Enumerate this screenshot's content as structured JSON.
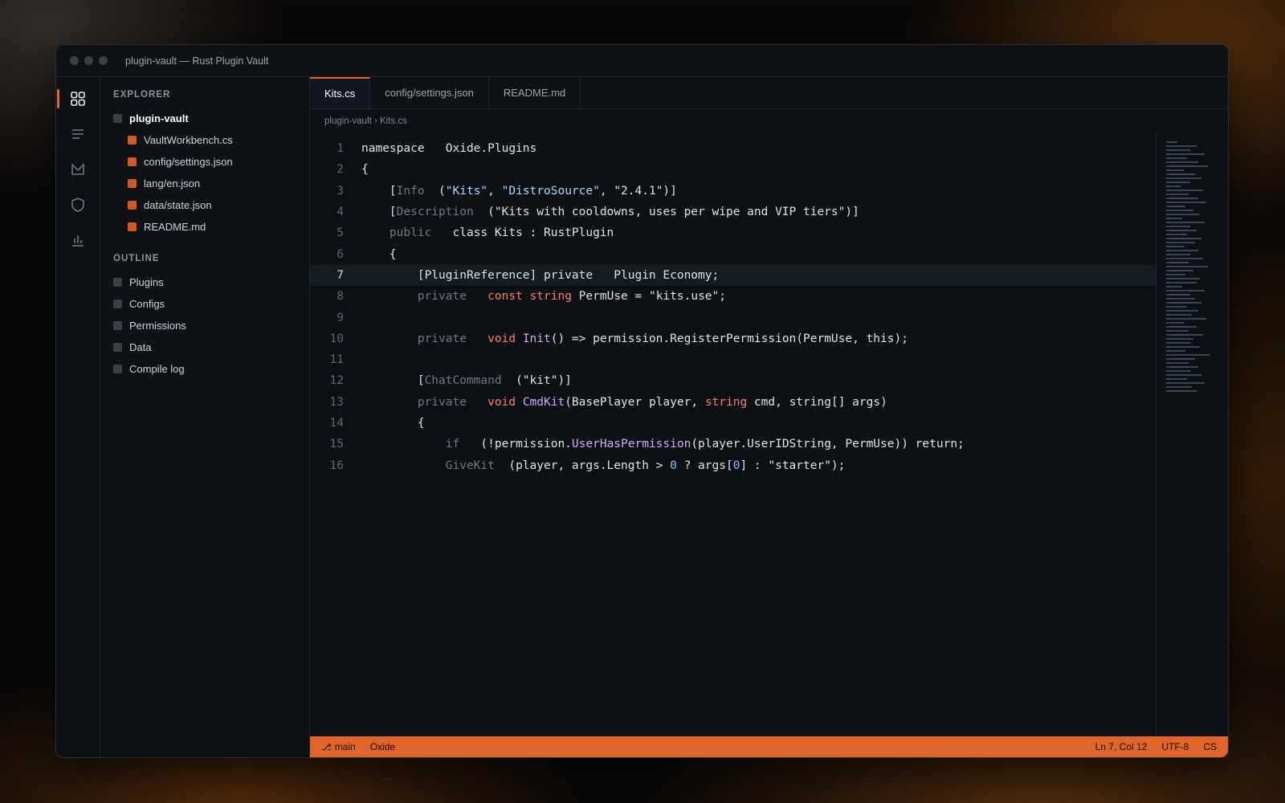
{
  "window": {
    "title": "plugin-vault — Rust Plugin Vault"
  },
  "activity_bar": {
    "items": [
      {
        "icon": "grid-icon",
        "active": true
      },
      {
        "icon": "list-icon",
        "active": false
      },
      {
        "icon": "mail-icon",
        "active": false
      },
      {
        "icon": "shield-icon",
        "active": false
      },
      {
        "icon": "chart-icon",
        "active": false
      }
    ]
  },
  "sidebar": {
    "explorer_title": "EXPLORER",
    "root": "plugin-vault",
    "files": [
      "VaultWorkbench.cs",
      "config/settings.json",
      "lang/en.json",
      "data/state.json",
      "README.md"
    ],
    "outline_title": "OUTLINE",
    "outline": [
      "Plugins",
      "Configs",
      "Permissions",
      "Data",
      "Compile log"
    ]
  },
  "tabs": [
    {
      "label": "Kits.cs",
      "active": true
    },
    {
      "label": "config/settings.json",
      "active": false
    },
    {
      "label": "README.md",
      "active": false
    }
  ],
  "breadcrumb": "plugin-vault › Kits.cs",
  "code": {
    "current_line": 7,
    "lines": [
      [
        {
          "t": "namespace   Oxide.Plugins"
        }
      ],
      [
        {
          "t": "{"
        }
      ],
      [
        {
          "t": "    ["
        },
        {
          "t": "Info",
          "c": "dim"
        },
        {
          "t": "  ("
        },
        {
          "t": "\"Kits\"",
          "c": "str"
        },
        {
          "t": ", "
        },
        {
          "t": "\"DistroSource\"",
          "c": "str"
        },
        {
          "t": ", \"2.4.1\")]"
        }
      ],
      [
        {
          "t": "    ["
        },
        {
          "t": "Description",
          "c": "dim"
        },
        {
          "t": "  (\"Kits with cooldowns, uses per wipe and VIP tiers\")]"
        }
      ],
      [
        {
          "t": "    "
        },
        {
          "t": "public",
          "c": "dim"
        },
        {
          "t": "   class Kits : RustPlugin"
        }
      ],
      [
        {
          "t": "    {"
        }
      ],
      [
        {
          "t": "        [PluginReference] private   Plugin Economy;"
        }
      ],
      [
        {
          "t": "        "
        },
        {
          "t": "private",
          "c": "dim"
        },
        {
          "t": "   "
        },
        {
          "t": "const",
          "c": "kw"
        },
        {
          "t": " "
        },
        {
          "t": "string",
          "c": "kw"
        },
        {
          "t": " PermUse = \"kits.use\";"
        }
      ],
      [
        {
          "t": ""
        }
      ],
      [
        {
          "t": "        "
        },
        {
          "t": "private",
          "c": "dim"
        },
        {
          "t": "   "
        },
        {
          "t": "void",
          "c": "kw"
        },
        {
          "t": " "
        },
        {
          "t": "Init",
          "c": "fn"
        },
        {
          "t": "() => permission.RegisterPermission(PermUse, this);"
        }
      ],
      [
        {
          "t": ""
        }
      ],
      [
        {
          "t": "        ["
        },
        {
          "t": "ChatCommand",
          "c": "dim"
        },
        {
          "t": "  (\"kit\")]"
        }
      ],
      [
        {
          "t": "        "
        },
        {
          "t": "private",
          "c": "dim"
        },
        {
          "t": "   "
        },
        {
          "t": "void",
          "c": "kw"
        },
        {
          "t": " "
        },
        {
          "t": "CmdKit",
          "c": "fn"
        },
        {
          "t": "(BasePlayer player, "
        },
        {
          "t": "string",
          "c": "kw"
        },
        {
          "t": " cmd, string[] args)"
        }
      ],
      [
        {
          "t": "        {"
        }
      ],
      [
        {
          "t": "            "
        },
        {
          "t": "if",
          "c": "dim"
        },
        {
          "t": "   (!permission."
        },
        {
          "t": "UserHasPermission",
          "c": "fn"
        },
        {
          "t": "(player.UserIDString, PermUse)) return;"
        }
      ],
      [
        {
          "t": "            "
        },
        {
          "t": "GiveKit",
          "c": "dim"
        },
        {
          "t": "  (player, args.Length > "
        },
        {
          "t": "0",
          "c": "num"
        },
        {
          "t": " ? args["
        },
        {
          "t": "0",
          "c": "num"
        },
        {
          "t": "] : \"starter\");"
        }
      ]
    ]
  },
  "statusbar": {
    "branch": "main",
    "runtime": "Oxide",
    "position": "Ln 7, Col 12",
    "encoding": "UTF-8",
    "language": "CS"
  },
  "colors": {
    "accent": "#e0652a",
    "background": "#0d1116"
  }
}
